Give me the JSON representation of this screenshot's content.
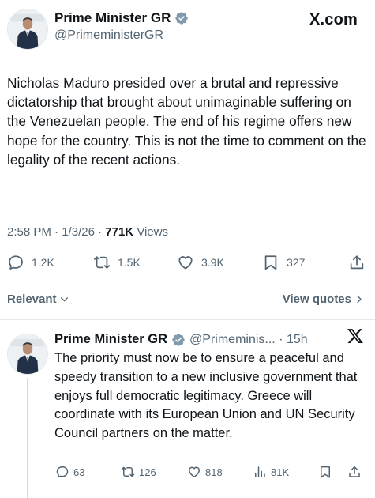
{
  "main_tweet": {
    "author_name": "Prime Minister GR",
    "author_handle": "@PrimeministerGR",
    "site_label": "X.com",
    "text": "Nicholas Maduro presided over a brutal and repressive dictatorship that brought about unimaginable suffering on the Venezuelan people. The end of his regime offers new hope for the country. This is not the time to comment on the legality of the recent actions.",
    "time": "2:58 PM",
    "date": "1/3/26",
    "separator": "·",
    "views_count": "771K",
    "views_label": "Views",
    "replies": "1.2K",
    "reposts": "1.5K",
    "likes": "3.9K",
    "bookmarks": "327"
  },
  "sort_bar": {
    "relevant_label": "Relevant",
    "view_quotes_label": "View quotes"
  },
  "reply_tweet": {
    "author_name": "Prime Minister GR",
    "handle_and_time": "@Primeminis... · 15h",
    "text": "The priority must now be to ensure a peaceful and speedy transition to a new inclusive government that enjoys full democratic legitimacy. Greece will coordinate with its European Union and UN Security Council partners on the matter.",
    "replies": "63",
    "reposts": "126",
    "likes": "818",
    "views": "81K"
  },
  "icons": {
    "verified": "verified-badge-icon",
    "reply": "reply-icon",
    "repost": "repost-icon",
    "like": "heart-icon",
    "bookmark": "bookmark-icon",
    "share": "share-icon",
    "views": "views-chart-icon",
    "x_logo": "x-logo-icon",
    "chevron_down": "chevron-down-icon",
    "chevron_right": "chevron-right-icon"
  },
  "colors": {
    "text": "#0f1419",
    "muted": "#536471",
    "verified_badge": "#829aab",
    "divider": "#e6e9ec"
  }
}
